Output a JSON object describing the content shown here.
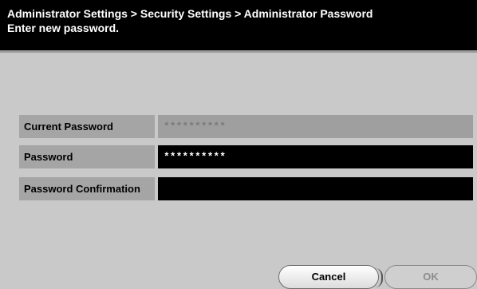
{
  "header": {
    "breadcrumb": "Administrator Settings > Security Settings > Administrator Password",
    "instruction": "Enter new password."
  },
  "form": {
    "current_password": {
      "label": "Current Password",
      "value": "**********",
      "state": "disabled"
    },
    "password": {
      "label": "Password",
      "value": "**********",
      "state": "active"
    },
    "password_confirmation": {
      "label": "Password Confirmation",
      "value": "",
      "state": "active"
    }
  },
  "buttons": {
    "cancel_label": "Cancel",
    "ok_label": "OK"
  },
  "colors": {
    "background": "#c9c9c9",
    "titlebar": "#000000",
    "label_bg": "#a5a5a5",
    "field_active": "#000000",
    "field_disabled": "#9f9f9f"
  }
}
